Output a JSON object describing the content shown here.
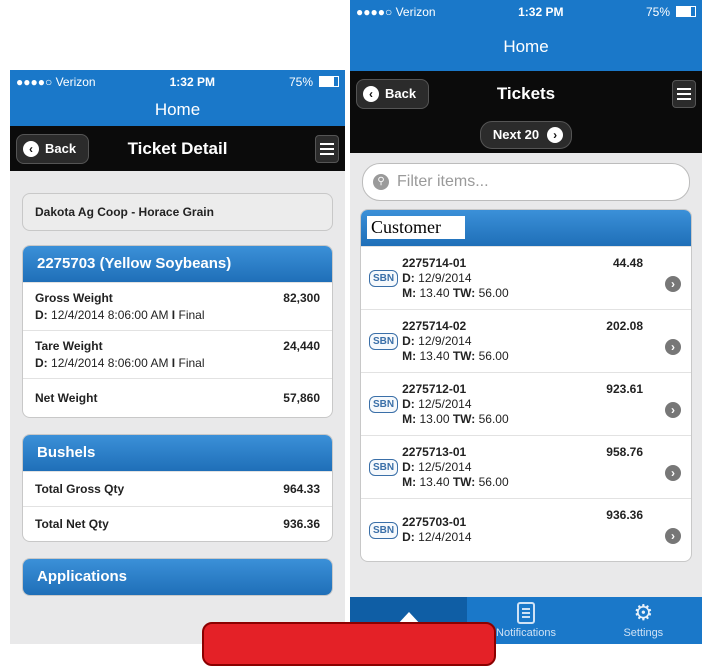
{
  "left": {
    "status": {
      "carrier": "●●●●○ Verizon",
      "time": "1:32 PM",
      "battery": "75%"
    },
    "title": "Home",
    "nav": {
      "back": "Back",
      "title": "Ticket Detail"
    },
    "location": "Dakota Ag Coop - Horace Grain",
    "ticket_card": {
      "header": "2275703 (Yellow Soybeans)",
      "rows": [
        {
          "label": "Gross Weight",
          "sub_prefix": "D:",
          "sub": "12/4/2014 8:06:00 AM",
          "sep": "I",
          "status": "Final",
          "value": "82,300"
        },
        {
          "label": "Tare Weight",
          "sub_prefix": "D:",
          "sub": "12/4/2014 8:06:00 AM",
          "sep": "I",
          "status": "Final",
          "value": "24,440"
        },
        {
          "label": "Net Weight",
          "value": "57,860"
        }
      ]
    },
    "bushels": {
      "header": "Bushels",
      "rows": [
        {
          "label": "Total Gross Qty",
          "value": "964.33"
        },
        {
          "label": "Total Net Qty",
          "value": "936.36"
        }
      ]
    },
    "applications": {
      "header": "Applications"
    }
  },
  "right": {
    "status": {
      "carrier": "●●●●○ Verizon",
      "time": "1:32 PM",
      "battery": "75%"
    },
    "title": "Home",
    "nav": {
      "back": "Back",
      "title": "Tickets"
    },
    "next": "Next 20",
    "filter_placeholder": "Filter items...",
    "customer_label": "Customer",
    "tickets": [
      {
        "badge": "SBN",
        "id": "2275714-01",
        "date": "12/9/2014",
        "m": "13.40",
        "tw": "56.00",
        "amount": "44.48"
      },
      {
        "badge": "SBN",
        "id": "2275714-02",
        "date": "12/9/2014",
        "m": "13.40",
        "tw": "56.00",
        "amount": "202.08"
      },
      {
        "badge": "SBN",
        "id": "2275712-01",
        "date": "12/5/2014",
        "m": "13.00",
        "tw": "56.00",
        "amount": "923.61"
      },
      {
        "badge": "SBN",
        "id": "2275713-01",
        "date": "12/5/2014",
        "m": "13.40",
        "tw": "56.00",
        "amount": "958.76"
      },
      {
        "badge": "SBN",
        "id": "2275703-01",
        "date": "12/4/2014",
        "m": "",
        "tw": "",
        "amount": "936.36"
      }
    ],
    "field_labels": {
      "d": "D:",
      "m": "M:",
      "tw": "TW:"
    },
    "tabs": [
      {
        "label": "",
        "icon": "home-icon"
      },
      {
        "label": "Notifications",
        "icon": "document-icon"
      },
      {
        "label": "Settings",
        "icon": "gear-icon"
      }
    ]
  },
  "colors": {
    "brand_blue": "#1a78c9",
    "alert_red": "#e42127"
  }
}
